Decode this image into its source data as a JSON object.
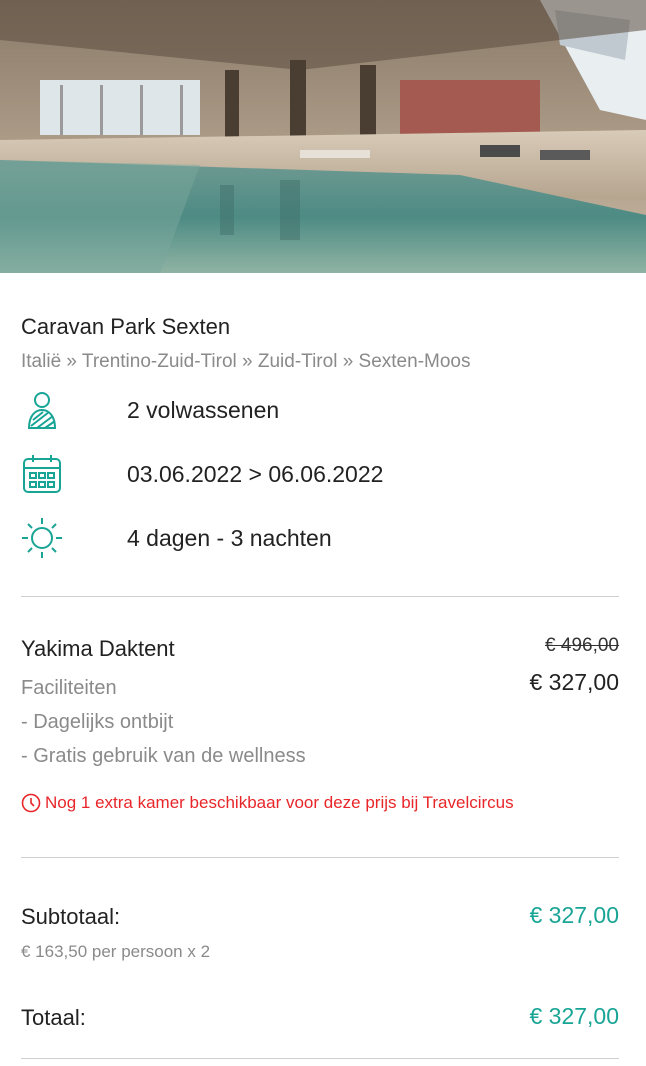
{
  "accommodation": {
    "name": "Caravan Park Sexten",
    "breadcrumb": "Italië » Trentino-Zuid-Tirol » Zuid-Tirol » Sexten-Moos"
  },
  "details": [
    {
      "icon": "person-icon",
      "text": "2 volwassenen"
    },
    {
      "icon": "calendar-icon",
      "text": "03.06.2022 > 06.06.2022"
    },
    {
      "icon": "sun-icon",
      "text": "4 dagen - 3 nachten"
    }
  ],
  "room": {
    "name": "Yakima Daktent",
    "price_old": "€ 496,00",
    "price_new": "€ 327,00",
    "facilities_title": "Faciliteiten",
    "facilities": [
      "- Dagelijks ontbijt",
      "- Gratis gebruik van de wellness"
    ],
    "alert": "Nog 1 extra kamer beschikbaar voor deze prijs bij Travelcircus"
  },
  "summary": {
    "subtotal_label": "Subtotaal:",
    "subtotal_value": "€ 327,00",
    "subtotal_note": "€ 163,50 per persoon x 2",
    "total_label": "Totaal:",
    "total_value": "€ 327,00"
  },
  "colors": {
    "accent": "#19a596",
    "alert": "#e8262a",
    "muted": "#8a8a8a"
  }
}
